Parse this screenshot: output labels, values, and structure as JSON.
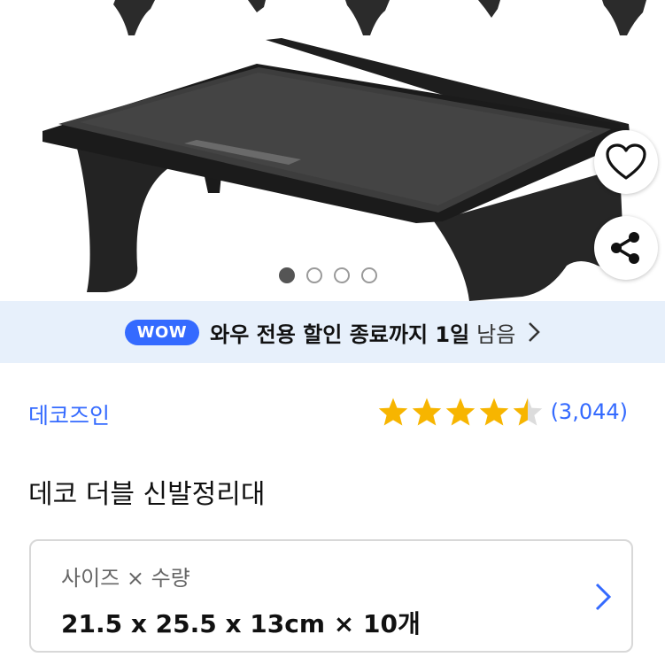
{
  "product_image": {
    "alt": "black double shoe rack",
    "carousel": {
      "pages": 4,
      "active_index": 0
    }
  },
  "actions": {
    "wishlist_icon": "heart-icon",
    "share_icon": "share-icon"
  },
  "wow_banner": {
    "badge": "WOW",
    "text": "와우 전용 할인 종료까지 1일",
    "tail": "남음"
  },
  "brand": {
    "name": "데코즈인"
  },
  "rating": {
    "stars": 4.5,
    "max": 5,
    "count_text": "(3,044)"
  },
  "product": {
    "title": "데코 더블 신발정리대"
  },
  "option": {
    "label": "사이즈 × 수량",
    "value": "21.5 x 25.5 x 13cm × 10개"
  },
  "colors": {
    "accent": "#346aff",
    "star": "#f7b500",
    "banner_bg": "#e7f0fb"
  }
}
